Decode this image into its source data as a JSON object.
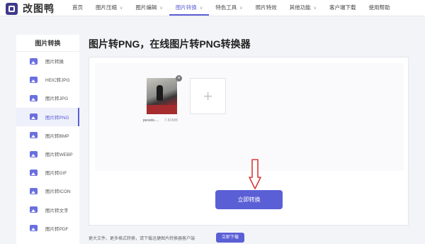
{
  "app": {
    "logo_text": "改图鸭"
  },
  "nav": [
    {
      "label": "首页",
      "has_caret": false
    },
    {
      "label": "图片压缩",
      "has_caret": true
    },
    {
      "label": "图片编辑",
      "has_caret": true
    },
    {
      "label": "图片转换",
      "has_caret": true,
      "active": true
    },
    {
      "label": "特色工具",
      "has_caret": true
    },
    {
      "label": "照片特效",
      "has_caret": false
    },
    {
      "label": "其他功能",
      "has_caret": true
    },
    {
      "label": "客户端下载",
      "has_caret": false
    },
    {
      "label": "使用帮助",
      "has_caret": false
    }
  ],
  "nav_caret": "∨",
  "sidebar": {
    "title": "图片转换",
    "items": [
      {
        "label": "图片转换"
      },
      {
        "label": "HEIC转JPG"
      },
      {
        "label": "图片转JPG"
      },
      {
        "label": "图片转PNG",
        "active": true
      },
      {
        "label": "图片转BMP"
      },
      {
        "label": "图片转WEBP"
      },
      {
        "label": "图片转GIF"
      },
      {
        "label": "图片转ICON"
      },
      {
        "label": "图片转文字"
      },
      {
        "label": "图片转PDF"
      }
    ]
  },
  "main": {
    "title": "图片转PNG，在线图片转PNG转换器",
    "file": {
      "name": "pexels-...",
      "size": "7.82MB",
      "remove_symbol": "×"
    },
    "add_symbol": "+",
    "convert_label": "立即转换"
  },
  "footer": {
    "text": "更大文件、更多格式转换，请下载迅捷图片转换器客户端",
    "download_label": "立即下载"
  },
  "colors": {
    "accent": "#5b5fd6",
    "arrow": "#d93a3a"
  }
}
